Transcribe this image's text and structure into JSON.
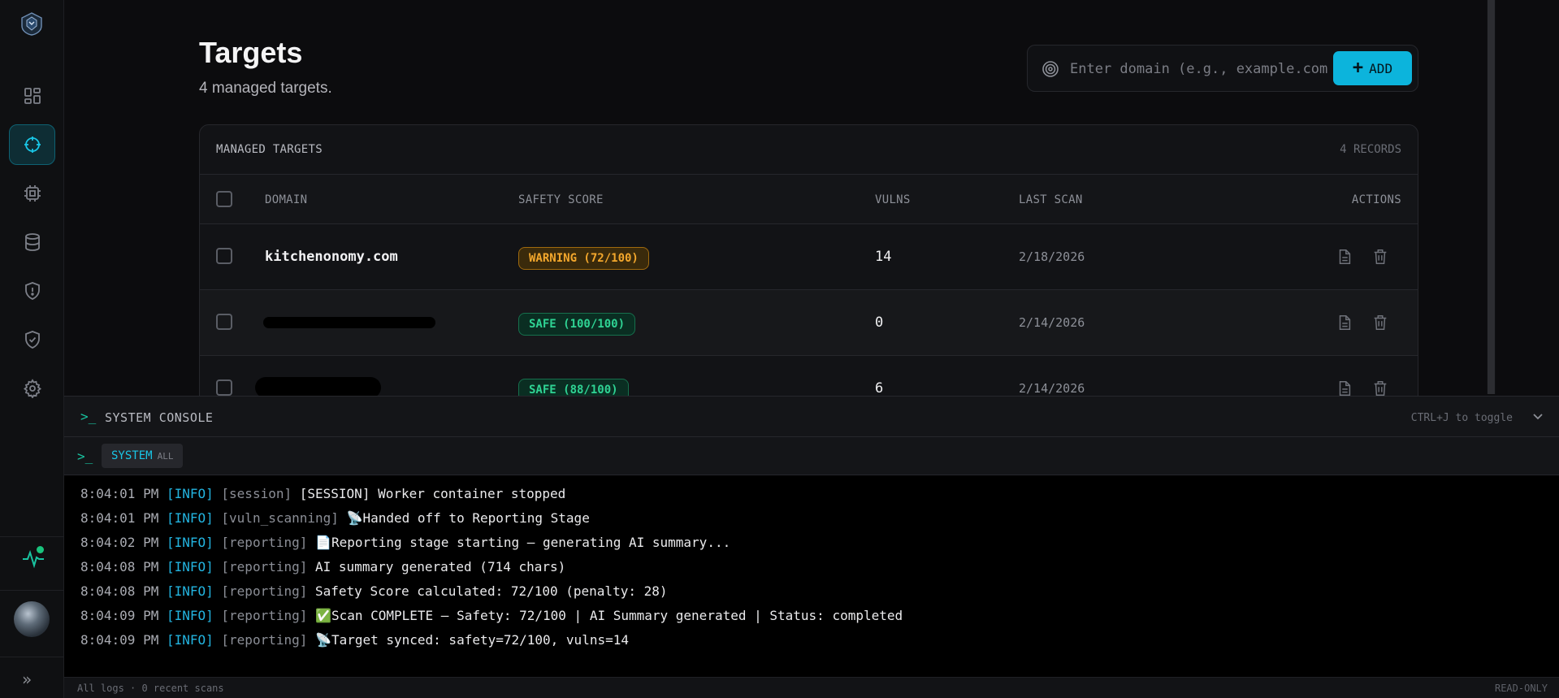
{
  "sidebar": {
    "items": [
      {
        "icon": "dashboard-icon",
        "active": false
      },
      {
        "icon": "crosshair-icon",
        "active": true
      },
      {
        "icon": "cpu-chip-icon",
        "active": false
      },
      {
        "icon": "database-icon",
        "active": false
      },
      {
        "icon": "shield-alert-icon",
        "active": false
      },
      {
        "icon": "shield-check-icon",
        "active": false
      },
      {
        "icon": "gear-icon",
        "active": false
      }
    ]
  },
  "header": {
    "title": "Targets",
    "subtitle": "4 managed targets."
  },
  "search": {
    "placeholder": "Enter domain (e.g., example.com)",
    "value": ""
  },
  "add_button": {
    "label": "ADD"
  },
  "table": {
    "title": "MANAGED TARGETS",
    "count": "4 RECORDS",
    "columns": {
      "domain": "DOMAIN",
      "safety": "SAFETY SCORE",
      "vulns": "VULNS",
      "last_scan": "LAST SCAN",
      "actions": "ACTIONS"
    },
    "rows": [
      {
        "domain": "kitchenonomy.com",
        "safety": "WARNING (72/100)",
        "status": "warning",
        "vulns": "14",
        "last_scan": "2/18/2026"
      },
      {
        "domain": "",
        "safety": "SAFE (100/100)",
        "status": "safe",
        "vulns": "0",
        "last_scan": "2/14/2026"
      },
      {
        "domain": "",
        "safety": "SAFE (88/100)",
        "status": "safe",
        "vulns": "6",
        "last_scan": "2/14/2026"
      }
    ]
  },
  "console": {
    "title": "SYSTEM CONSOLE",
    "hint": "CTRL+J to toggle",
    "tab": {
      "label": "SYSTEM",
      "sub": "ALL"
    },
    "logs": [
      {
        "time": "8:04:01 PM",
        "level": "[INFO]",
        "source": "[session]",
        "message": "[SESSION] Worker container stopped"
      },
      {
        "time": "8:04:01 PM",
        "level": "[INFO]",
        "source": "[vuln_scanning]",
        "message": "📡Handed off to Reporting Stage"
      },
      {
        "time": "8:04:02 PM",
        "level": "[INFO]",
        "source": "[reporting]",
        "message": "📄Reporting stage starting — generating AI summary..."
      },
      {
        "time": "8:04:08 PM",
        "level": "[INFO]",
        "source": "[reporting]",
        "message": "AI summary generated (714 chars)"
      },
      {
        "time": "8:04:08 PM",
        "level": "[INFO]",
        "source": "[reporting]",
        "message": "Safety Score calculated: 72/100 (penalty: 28)"
      },
      {
        "time": "8:04:09 PM",
        "level": "[INFO]",
        "source": "[reporting]",
        "message": "✅Scan COMPLETE — Safety: 72/100 | AI Summary generated | Status: completed"
      },
      {
        "time": "8:04:09 PM",
        "level": "[INFO]",
        "source": "[reporting]",
        "message": "📡Target synced: safety=72/100, vulns=14"
      }
    ],
    "status_left": "All logs · 0 recent scans",
    "status_right": "READ-ONLY"
  },
  "colors": {
    "accent": "#0cb4dc",
    "warning": "#f3a72c",
    "safe": "#2fd394",
    "info": "#23b4e0"
  }
}
